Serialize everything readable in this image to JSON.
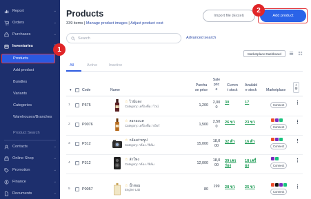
{
  "sidebar": {
    "items": [
      {
        "label": "Report",
        "icon": "chart-icon"
      },
      {
        "label": "Orders",
        "icon": "cart-icon"
      },
      {
        "label": "Purchases",
        "icon": "bag-icon"
      },
      {
        "label": "Inventories",
        "icon": "box-icon"
      }
    ],
    "inventory_sub": [
      "Products",
      "Add product",
      "Bundles",
      "Variants",
      "Categories",
      "Warehouses/Branches",
      "Product Search"
    ],
    "bottom_items": [
      {
        "label": "Contacts",
        "icon": "contacts-icon"
      },
      {
        "label": "Online Shop",
        "icon": "shop-icon"
      },
      {
        "label": "Promotion",
        "icon": "tag-icon"
      },
      {
        "label": "Finance",
        "icon": "finance-icon"
      },
      {
        "label": "Documents",
        "icon": "doc-icon"
      }
    ]
  },
  "callouts": {
    "one": "1",
    "two": "2"
  },
  "header": {
    "title": "Products",
    "count": "339 items",
    "sep": " | ",
    "manage_images": "Manage product images",
    "adjust_cost": "Adjust product cost",
    "import_label": "Import file (Excel)",
    "add_label": "Add product"
  },
  "search": {
    "placeholder": "Search",
    "advanced": "Advanced search"
  },
  "marketplace_dashboard": "Marketplace Dashboard",
  "tabs": [
    "All",
    "Active",
    "Inactive"
  ],
  "table": {
    "headers": {
      "code": "Code",
      "name": "Name",
      "purchase_price_1": "Purcha",
      "purchase_price_2": "se price",
      "sale_price_1": "Sale",
      "sale_price_2": "pric",
      "sale_price_3": "e",
      "current_stock_1": "Curren",
      "current_stock_2": "t stock",
      "available_stock_1": "Availabl",
      "available_stock_2": "e stock",
      "marketplace": "Marketplace"
    },
    "settings_glyph_top": "+",
    "settings_glyph_bottom": "⚙",
    "rows": [
      {
        "num": "1",
        "code": "P575",
        "name": "ไวน์แดง",
        "category": "Category: เครื่องดื่ม / ไวน์",
        "purchase": "1,200",
        "sale_1": "2,00",
        "sale_2": "0",
        "stock_1": "30",
        "stock_2": "",
        "avail_1": "17",
        "avail_2": "",
        "connect": "Connect"
      },
      {
        "num": "2",
        "code": "P0076",
        "name": "ลอกอะแค",
        "category": "Category: เครื่องดื่ม / เบียร์",
        "purchase": "1,500",
        "sale_1": "2,50",
        "sale_2": "0",
        "stock_1": "26 ขว",
        "stock_2": "",
        "avail_1": "23 ขว",
        "avail_2": "",
        "connect": "Connect"
      },
      {
        "num": "3",
        "code": "P312",
        "name": "กล้องถ่ายรูป",
        "category": "Category: กล้อง / ฟิล์ม",
        "purchase": "15,000",
        "sale_1": "18,0",
        "sale_2": "00",
        "stock_1": "32 ตัว",
        "stock_2": "",
        "avail_1": "16 ตัว",
        "avail_2": "",
        "connect": "Connect"
      },
      {
        "num": "4",
        "code": "P312",
        "name": "ลำโพง",
        "category": "Category: กล้อง / ฟิล์ม",
        "purchase": "12,000",
        "sale_1": "18,0",
        "sale_2": "00",
        "stock_1": "39 เคร",
        "stock_2": "ร่อง",
        "avail_1": "18 เครื่",
        "avail_2": "อง",
        "connect": "Connect"
      },
      {
        "num": "5",
        "code": "P0057",
        "name": "น้ำหอม",
        "category": "Engine Lab",
        "purchase": "80",
        "sale_1": "199",
        "sale_2": "",
        "stock_1": "28 ขว",
        "stock_2": "",
        "avail_1": "25 ขว",
        "avail_2": "",
        "connect": "Connect"
      }
    ]
  },
  "colors": {
    "sidebar": "#1d2f6d",
    "accent": "#2b59e0",
    "callout": "#e02628",
    "stock": "#1e9c56"
  }
}
